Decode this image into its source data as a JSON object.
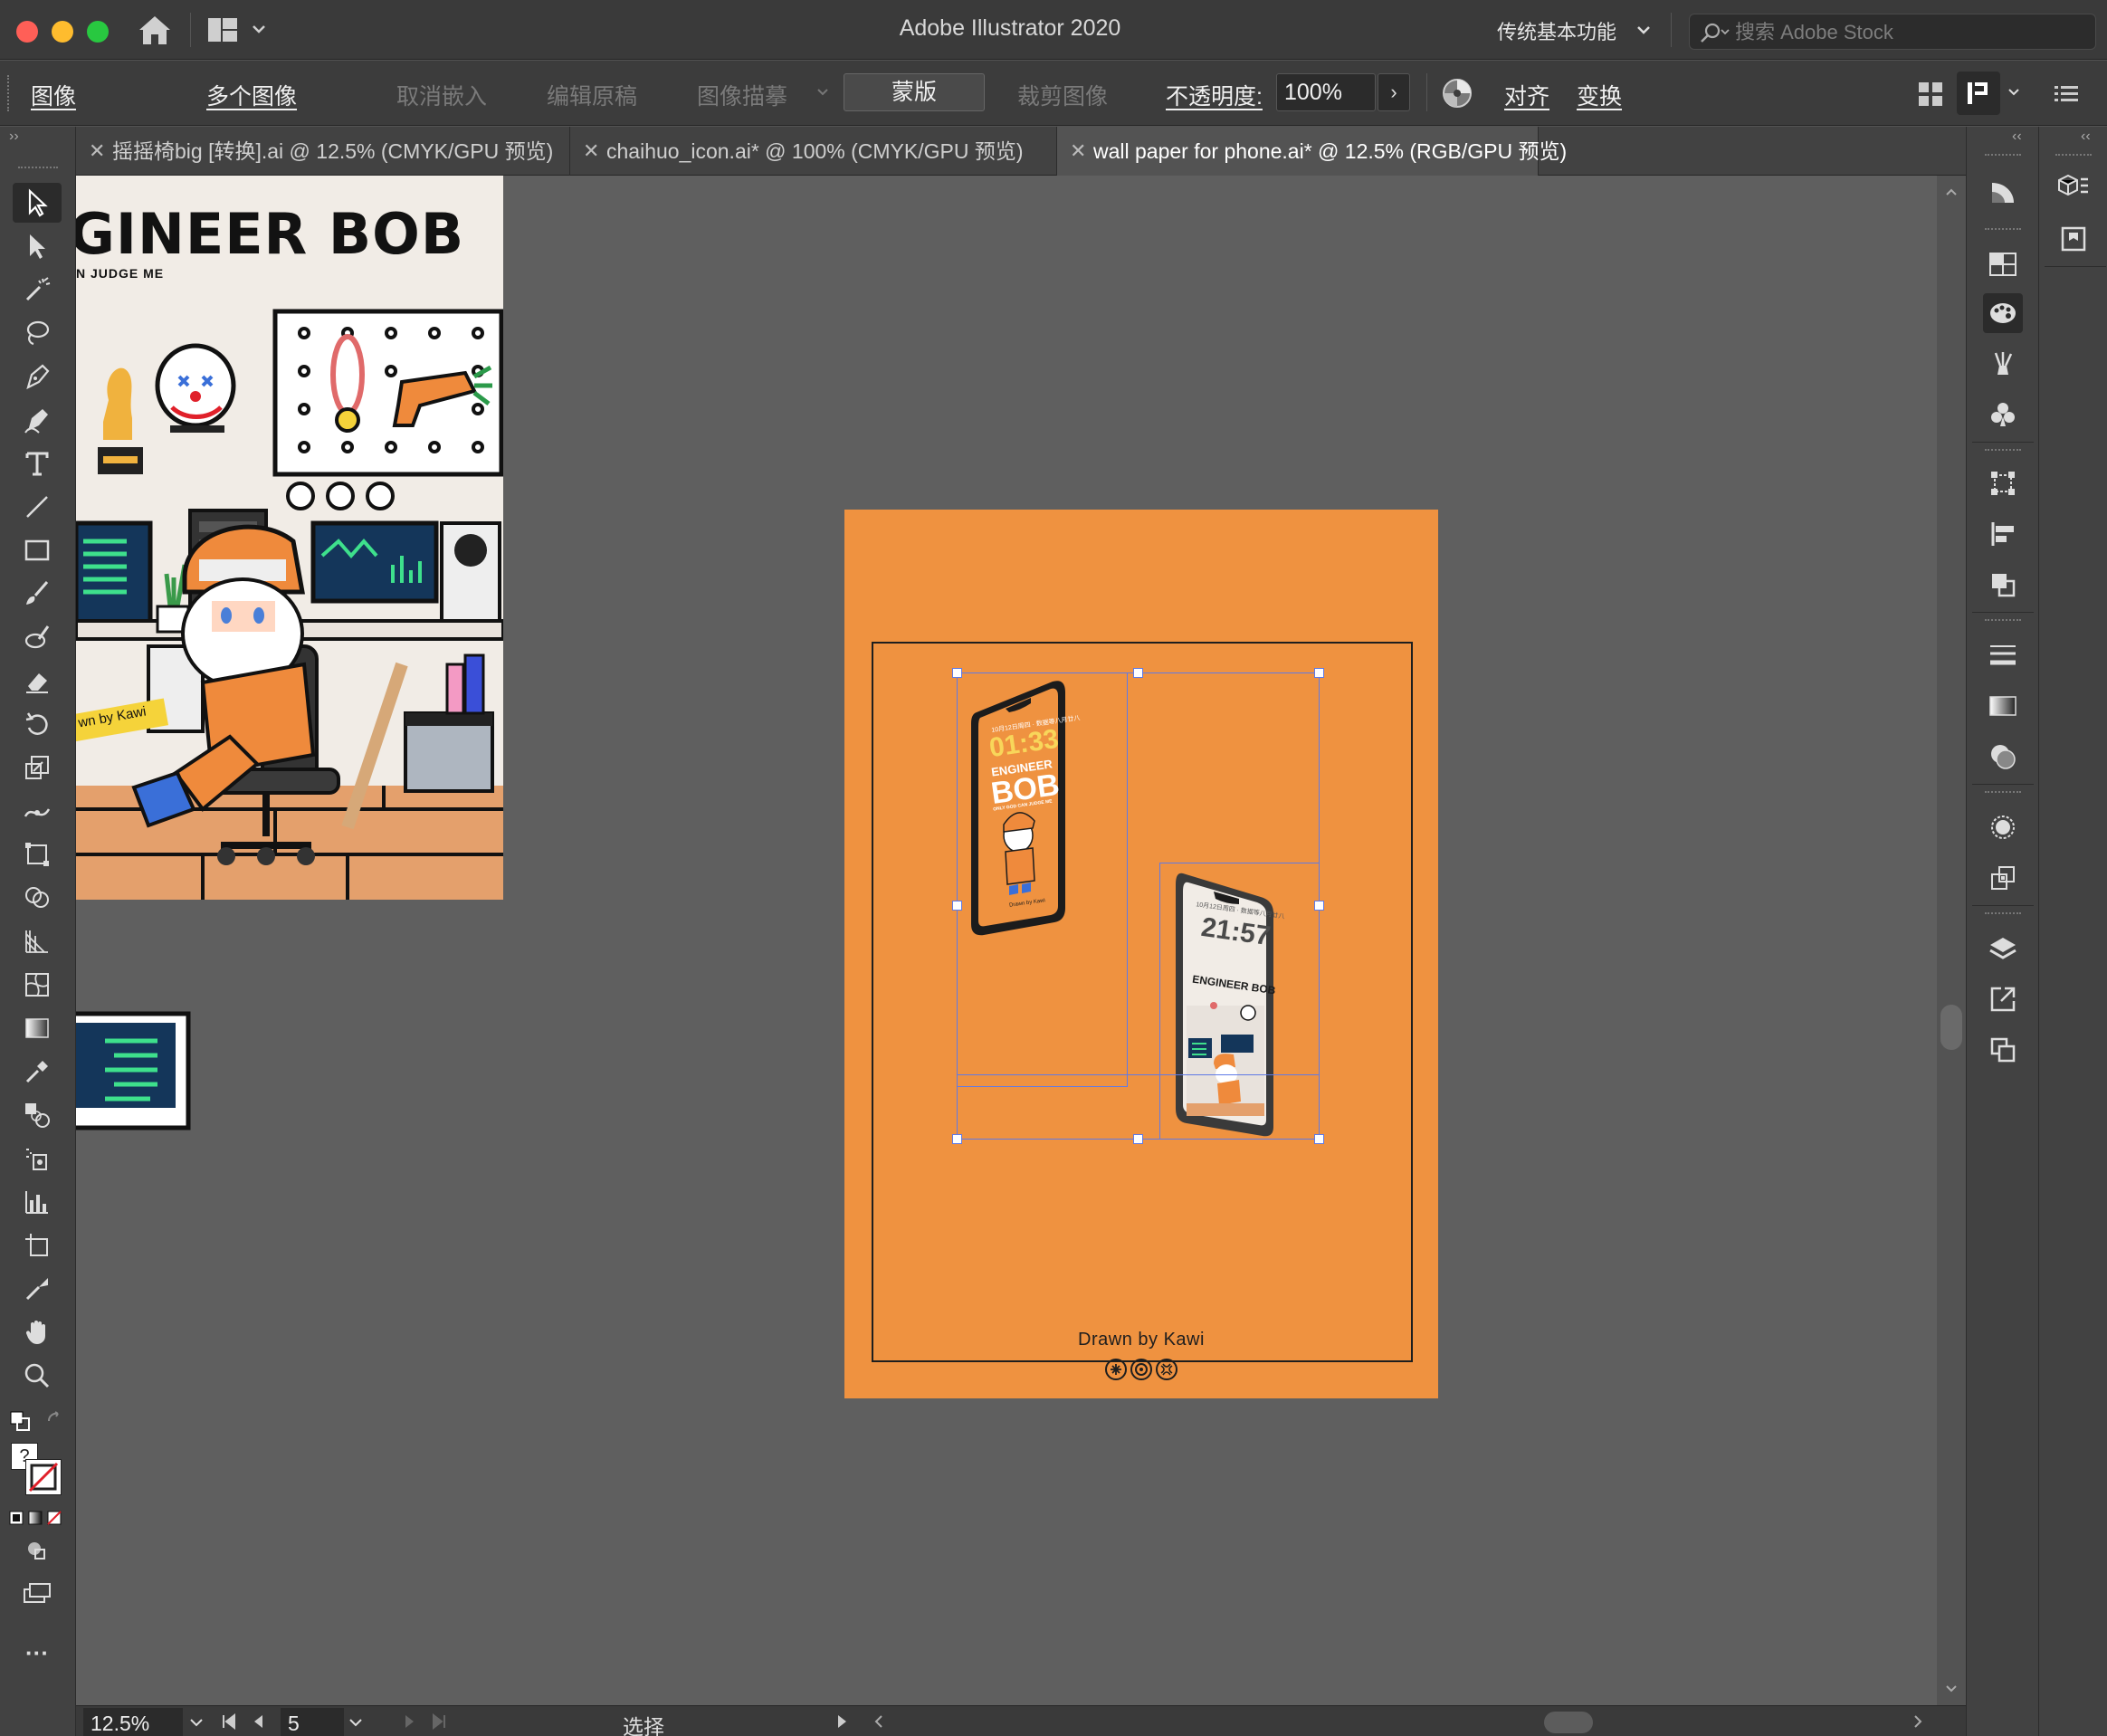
{
  "window": {
    "title": "Adobe Illustrator 2020",
    "workspace": "传统基本功能",
    "stock_search_placeholder": "搜索 Adobe Stock"
  },
  "controlbar": {
    "image_label": "图像",
    "multi_image": "多个图像",
    "unembed": "取消嵌入",
    "edit_original": "编辑原稿",
    "image_trace": "图像描摹",
    "mask": "蒙版",
    "crop_image": "裁剪图像",
    "opacity_label": "不透明度:",
    "opacity_value": "100%",
    "align": "对齐",
    "transform": "变换"
  },
  "tabs": [
    {
      "label": "摇摇椅big [转换].ai @ 12.5% (CMYK/GPU 预览)",
      "active": false
    },
    {
      "label": "chaihuo_icon.ai* @ 100% (CMYK/GPU 预览)",
      "active": false
    },
    {
      "label": "wall paper for phone.ai* @ 12.5% (RGB/GPU 预览)",
      "active": true
    }
  ],
  "artwork": {
    "poster_title": "GINEER BOB",
    "poster_subtitle": "N JUDGE ME",
    "poster_sticker": "wn by Kawi"
  },
  "artboard": {
    "phone1_date": "10月12日周四 · 数据等八月廿八",
    "phone1_time": "01:33",
    "phone1_brand_top": "ENGINEER",
    "phone1_brand_bottom": "BOB",
    "phone1_tagline": "ONLY GOD CAN JUDGE ME",
    "phone1_caption": "Drawn by Kawi",
    "phone2_date": "10月12日周四 · 数据等八月廿八",
    "phone2_time": "21:57",
    "phone2_brand": "ENGINEER BOB",
    "caption": "Drawn by Kawi"
  },
  "statusbar": {
    "zoom": "12.5%",
    "page": "5",
    "mode": "选择"
  },
  "colors": {
    "accent_orange": "#ef9240",
    "selection_blue": "#5f7ae6",
    "canvas_bg": "#5f5f5f",
    "ui_dark": "#424242"
  }
}
